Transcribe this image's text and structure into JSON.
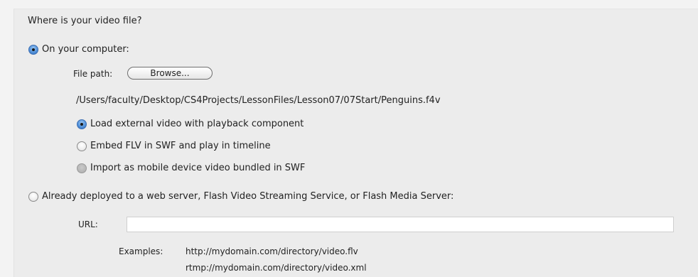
{
  "heading": "Where is your video file?",
  "local_option": {
    "label": "On your computer:",
    "selected": true,
    "file_path_label": "File path:",
    "browse_label": "Browse...",
    "file_path": "/Users/faculty/Desktop/CS4Projects/LessonFiles/Lesson07/07Start/Penguins.f4v",
    "sub_options": [
      {
        "label": "Load external video with playback component",
        "state": "selected"
      },
      {
        "label": "Embed FLV in SWF and play in timeline",
        "state": "unselected"
      },
      {
        "label": "Import as mobile device video bundled in SWF",
        "state": "disabled"
      }
    ]
  },
  "server_option": {
    "label": "Already deployed to a web server, Flash Video Streaming Service, or Flash Media Server:",
    "selected": false,
    "url_label": "URL:",
    "url_value": "",
    "examples_label": "Examples:",
    "examples": [
      "http://mydomain.com/directory/video.flv",
      "rtmp://mydomain.com/directory/video.xml"
    ]
  }
}
